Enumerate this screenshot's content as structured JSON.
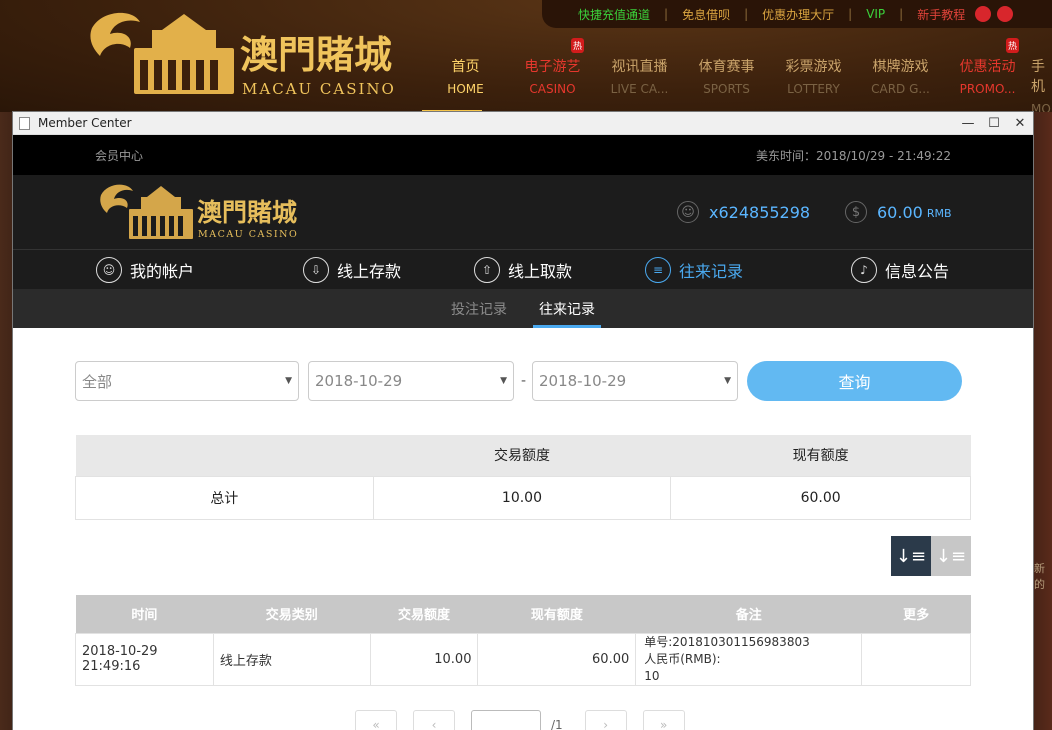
{
  "site": {
    "topbar": {
      "links": [
        "快捷充值通道",
        "免息借呗",
        "优惠办理大厅",
        "VIP",
        "新手教程"
      ]
    },
    "logo": {
      "cn": "澳門賭城",
      "en": "MACAU CASINO"
    },
    "nav": [
      {
        "cn": "首页",
        "en": "HOME",
        "hot": ""
      },
      {
        "cn": "电子游艺",
        "en": "CASINO",
        "hot": "热"
      },
      {
        "cn": "视讯直播",
        "en": "LIVE CA...",
        "hot": ""
      },
      {
        "cn": "体育赛事",
        "en": "SPORTS",
        "hot": ""
      },
      {
        "cn": "彩票游戏",
        "en": "LOTTERY",
        "hot": ""
      },
      {
        "cn": "棋牌游戏",
        "en": "CARD G...",
        "hot": ""
      },
      {
        "cn": "优惠活动",
        "en": "PROMO...",
        "hot": "热"
      },
      {
        "cn": "手机",
        "en": "MO",
        "hot": ""
      }
    ],
    "side_note": "新的"
  },
  "window": {
    "title": "Member Center",
    "controls": {
      "minimize": "—",
      "maximize": "☐",
      "close": "✕"
    }
  },
  "member": {
    "top_left": "会员中心",
    "time": "美东时间：2018/10/29 - 21:49:22",
    "logo": {
      "cn": "澳門賭城",
      "en": "MACAU CASINO"
    },
    "username": "x624855298",
    "balance": "60.00",
    "currency": "RMB",
    "tabs": [
      "我的帐户",
      "线上存款",
      "线上取款",
      "往来记录",
      "信息公告"
    ],
    "subtabs": [
      "投注记录",
      "往来记录"
    ]
  },
  "filters": {
    "type": "全部",
    "date_from": "2018-10-29",
    "date_to": "2018-10-29",
    "dash": "-",
    "query_label": "查询"
  },
  "summary": {
    "headers": [
      "",
      "交易额度",
      "现有额度"
    ],
    "row": [
      "总计",
      "10.00",
      "60.00"
    ]
  },
  "records": {
    "headers": [
      "时间",
      "交易类别",
      "交易额度",
      "现有额度",
      "备注",
      "更多"
    ],
    "rows": [
      {
        "time": "2018-10-29 21:49:16",
        "type": "线上存款",
        "amount": "10.00",
        "balance": "60.00",
        "note_line1": "单号:201810301156983803",
        "note_line2": "人民币(RMB):",
        "note_line3": "10",
        "more": ""
      }
    ]
  },
  "pager": {
    "total": "/1"
  }
}
